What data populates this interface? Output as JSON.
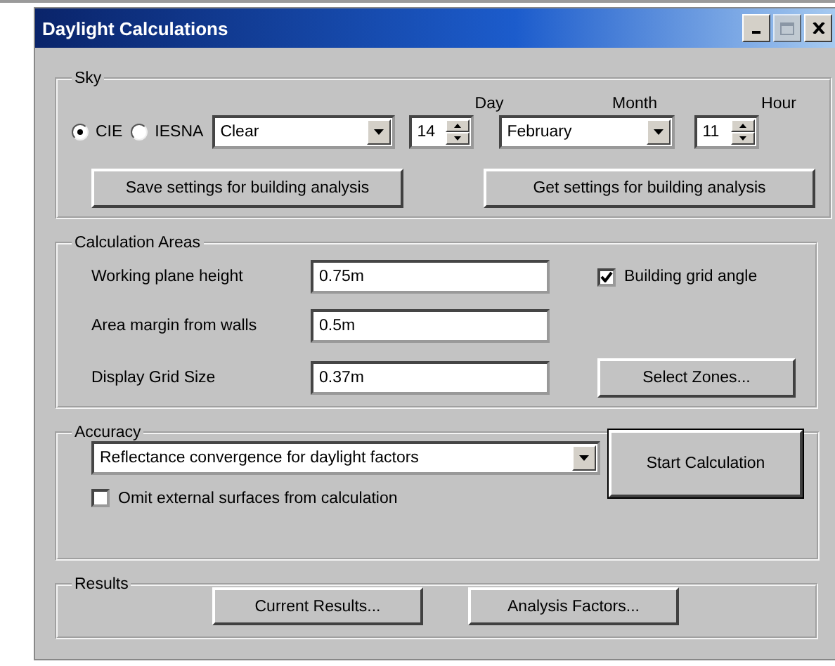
{
  "window": {
    "title": "Daylight Calculations"
  },
  "sky": {
    "label": "Sky",
    "models": [
      {
        "label": "CIE",
        "selected": true
      },
      {
        "label": "IESNA",
        "selected": false
      }
    ],
    "sky_type": {
      "value": "Clear"
    },
    "day": {
      "label": "Day",
      "value": "14"
    },
    "month": {
      "label": "Month",
      "value": "February"
    },
    "hour": {
      "label": "Hour",
      "value": "11"
    },
    "buttons": [
      "Save settings for building analysis",
      "Get settings for building analysis"
    ]
  },
  "calculation_areas": {
    "label": "Calculation Areas",
    "fields": [
      {
        "label": "Working plane height",
        "value": "0.75m"
      },
      {
        "label": "Area margin from walls",
        "value": "0.5m"
      },
      {
        "label": "Display Grid Size",
        "value": "0.37m"
      }
    ],
    "building_grid_angle": {
      "label": "Building grid angle",
      "checked": true
    },
    "select_zones_button": "Select Zones..."
  },
  "accuracy": {
    "label": "Accuracy",
    "method": {
      "value": "Reflectance convergence for daylight factors"
    },
    "omit_external": {
      "label": "Omit external surfaces from calculation",
      "checked": false
    },
    "start_button": "Start Calculation"
  },
  "results": {
    "label": "Results",
    "buttons": [
      "Current Results...",
      "Analysis Factors..."
    ]
  }
}
